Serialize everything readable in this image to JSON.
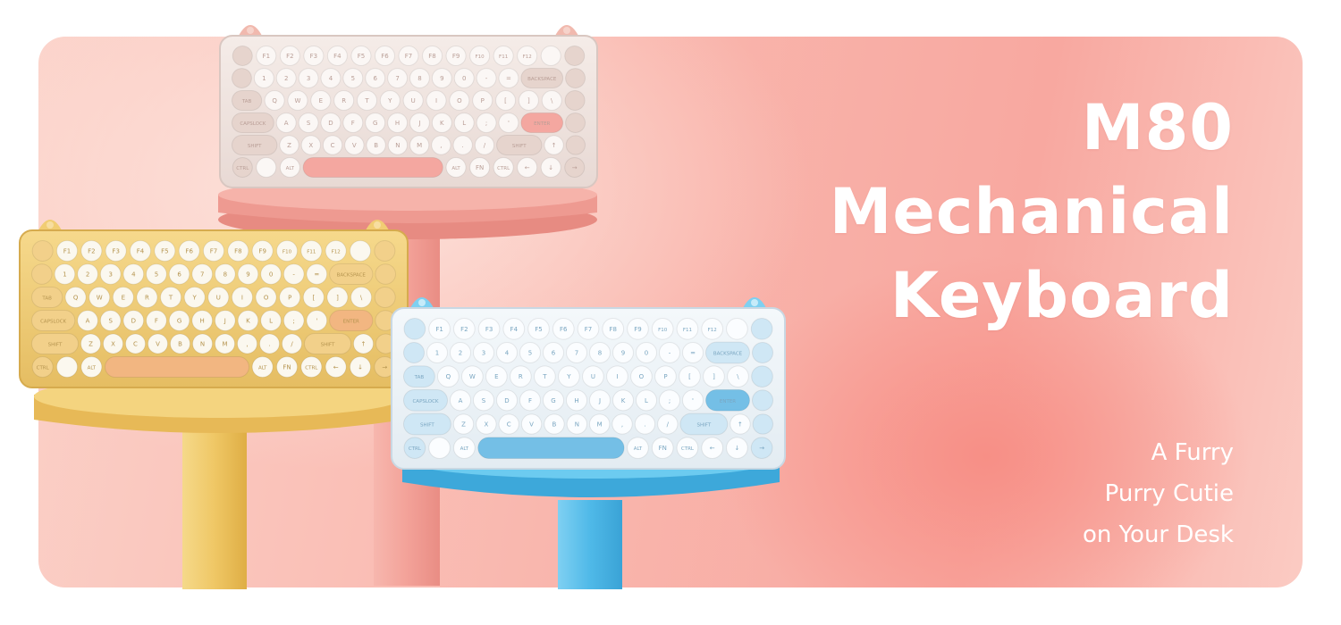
{
  "promo": {
    "title_line1": "M80",
    "title_line2": "Mechanical",
    "title_line3": "Keyboard",
    "tagline_line1": "A Furry",
    "tagline_line2": "Purry Cutie",
    "tagline_line3": "on Your Desk"
  },
  "colors": {
    "background": "#f9b6ad",
    "pink_stand": "#f3a39b",
    "yellow_stand": "#f1cd73",
    "blue_stand": "#5cc0ea",
    "text": "#ffffff"
  },
  "keyboards": [
    {
      "name": "pink",
      "rows": [
        [
          "",
          "F1",
          "F2",
          "F3",
          "F4",
          "F5",
          "F6",
          "F7",
          "F8",
          "F9",
          "F10",
          "F11",
          "F12",
          "",
          ""
        ],
        [
          "",
          "1",
          "2",
          "3",
          "4",
          "5",
          "6",
          "7",
          "8",
          "9",
          "0",
          "-",
          "=",
          "BACKSPACE",
          ""
        ],
        [
          "TAB",
          "Q",
          "W",
          "E",
          "R",
          "T",
          "Y",
          "U",
          "I",
          "O",
          "P",
          "[",
          "]",
          "\\",
          ""
        ],
        [
          "CAPSLOCK",
          "A",
          "S",
          "D",
          "F",
          "G",
          "H",
          "J",
          "K",
          "L",
          ";",
          "'",
          "ENTER",
          ""
        ],
        [
          "SHIFT",
          "Z",
          "X",
          "C",
          "V",
          "B",
          "N",
          "M",
          ",",
          ".",
          "/",
          "SHIFT",
          "↑",
          ""
        ],
        [
          "CTRL",
          "",
          "ALT",
          "",
          "ALT",
          "FN",
          "CTRL",
          "←",
          "↓",
          "→"
        ]
      ]
    },
    {
      "name": "yellow",
      "rows": [
        [
          "",
          "F1",
          "F2",
          "F3",
          "F4",
          "F5",
          "F6",
          "F7",
          "F8",
          "F9",
          "F10",
          "F11",
          "F12",
          "",
          ""
        ],
        [
          "",
          "1",
          "2",
          "3",
          "4",
          "5",
          "6",
          "7",
          "8",
          "9",
          "0",
          "-",
          "=",
          "BACKSPACE",
          ""
        ],
        [
          "TAB",
          "Q",
          "W",
          "E",
          "R",
          "T",
          "Y",
          "U",
          "I",
          "O",
          "P",
          "[",
          "]",
          "\\",
          ""
        ],
        [
          "CAPSLOCK",
          "A",
          "S",
          "D",
          "F",
          "G",
          "H",
          "J",
          "K",
          "L",
          ";",
          "'",
          "ENTER",
          ""
        ],
        [
          "SHIFT",
          "Z",
          "X",
          "C",
          "V",
          "B",
          "N",
          "M",
          ",",
          ".",
          "/",
          "SHIFT",
          "↑",
          ""
        ],
        [
          "CTRL",
          "",
          "ALT",
          "",
          "ALT",
          "FN",
          "CTRL",
          "←",
          "↓",
          "→"
        ]
      ]
    },
    {
      "name": "blue",
      "rows": [
        [
          "",
          "F1",
          "F2",
          "F3",
          "F4",
          "F5",
          "F6",
          "F7",
          "F8",
          "F9",
          "F10",
          "F11",
          "F12",
          "",
          ""
        ],
        [
          "",
          "1",
          "2",
          "3",
          "4",
          "5",
          "6",
          "7",
          "8",
          "9",
          "0",
          "-",
          "=",
          "BACKSPACE",
          ""
        ],
        [
          "TAB",
          "Q",
          "W",
          "E",
          "R",
          "T",
          "Y",
          "U",
          "I",
          "O",
          "P",
          "[",
          "]",
          "\\",
          ""
        ],
        [
          "CAPSLOCK",
          "A",
          "S",
          "D",
          "F",
          "G",
          "H",
          "J",
          "K",
          "L",
          ";",
          "'",
          "ENTER",
          ""
        ],
        [
          "SHIFT",
          "Z",
          "X",
          "C",
          "V",
          "B",
          "N",
          "M",
          ",",
          ".",
          "/",
          "SHIFT",
          "↑",
          ""
        ],
        [
          "CTRL",
          "",
          "ALT",
          "",
          "ALT",
          "FN",
          "CTRL",
          "←",
          "↓",
          "→"
        ]
      ]
    }
  ]
}
